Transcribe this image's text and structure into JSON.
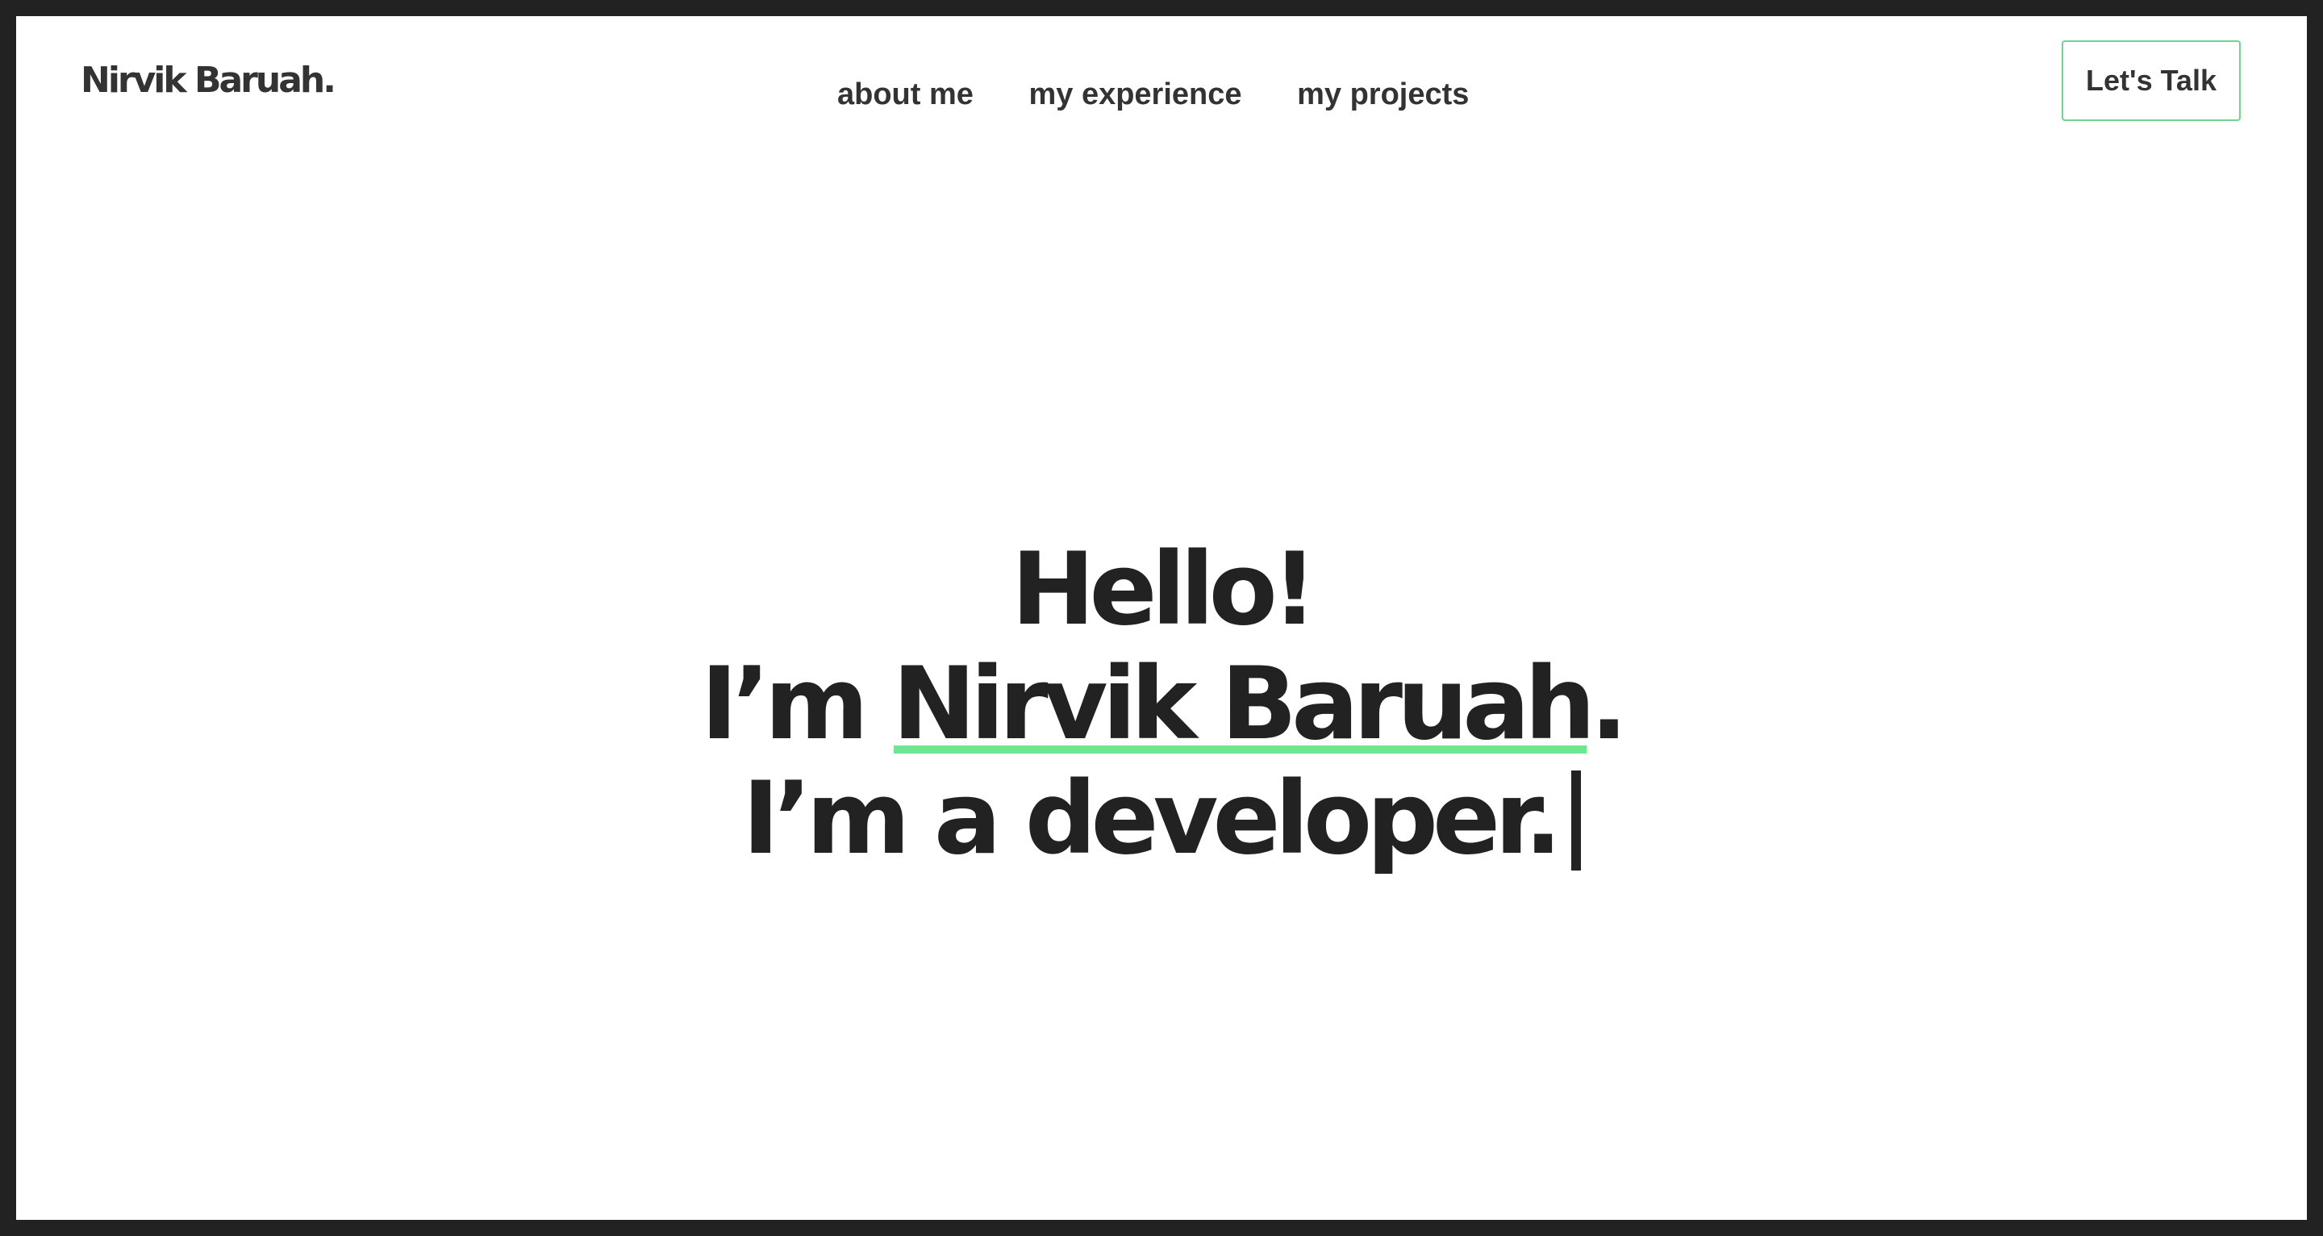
{
  "header": {
    "logo_text": "Nirvik Baruah.",
    "nav": [
      {
        "label": "about me"
      },
      {
        "label": "my experience"
      },
      {
        "label": "my projects"
      }
    ],
    "cta_label": "Let's Talk"
  },
  "hero": {
    "line1": "Hello!",
    "line2_prefix": "I’m ",
    "name": "Nirvik Baruah",
    "line2_suffix": ".",
    "line3": "I’m a developer.",
    "underline_color": "#6ee692"
  },
  "colors": {
    "frame_border": "#222222",
    "background": "#ffffff",
    "text": "#222222",
    "accent": "#6fd48f"
  }
}
